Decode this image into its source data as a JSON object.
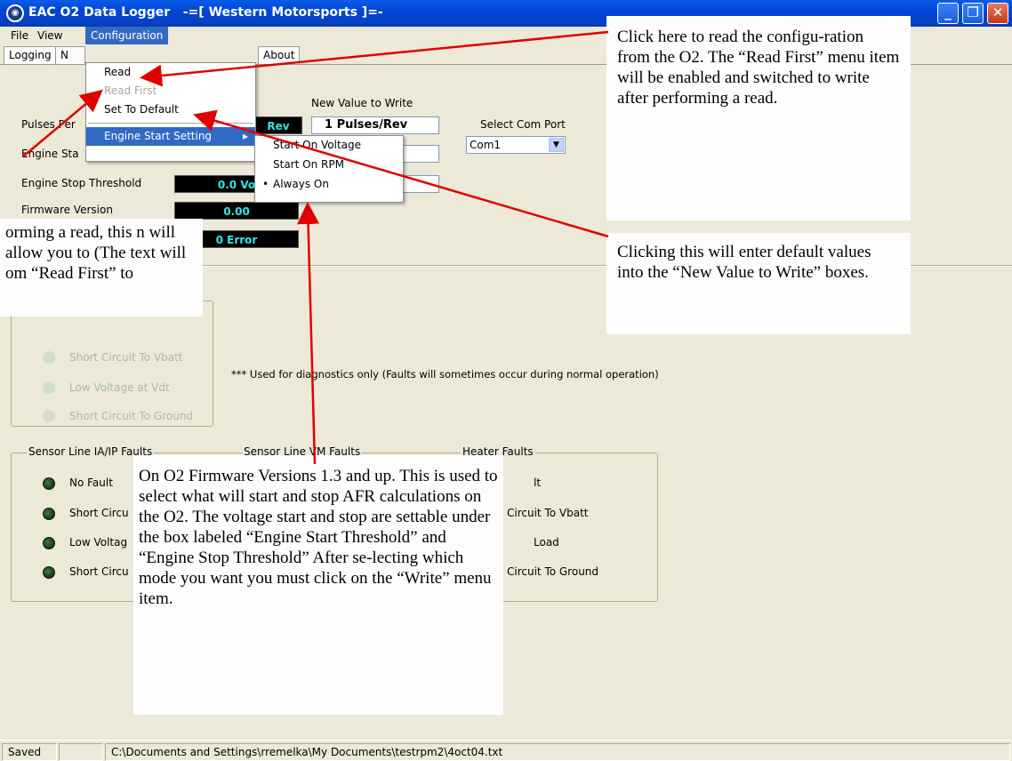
{
  "window": {
    "title": "EAC O2 Data Logger   -=[ Western Motorsports ]=-",
    "app_icon": "gecko-logo-icon",
    "minimize_icon": "minimize-icon",
    "maximize_icon": "maximize-icon",
    "close_icon": "close-icon",
    "minimize_glyph": "_",
    "maximize_glyph": "❐",
    "close_glyph": "✕"
  },
  "menubar": {
    "items": [
      "File",
      "View",
      "Configuration"
    ]
  },
  "tabs": {
    "items": [
      "Logging",
      "N",
      "About"
    ]
  },
  "configuration_menu": {
    "items": [
      {
        "label": "Read",
        "enabled": true
      },
      {
        "label": "Read First",
        "enabled": false
      },
      {
        "label": "Set To Default",
        "enabled": true
      },
      {
        "label": "Engine Start Setting",
        "enabled": true,
        "has_submenu": true
      }
    ]
  },
  "engine_start_submenu": {
    "items": [
      {
        "label": "Start On Voltage",
        "checked": false
      },
      {
        "label": "Start On RPM",
        "checked": false
      },
      {
        "label": "Always On",
        "checked": true
      }
    ],
    "bullet": "•",
    "submenu_arrow": "▸"
  },
  "config": {
    "new_value_header": "New Value to Write",
    "rows": [
      {
        "label": "Pulses Per",
        "display": "Rev",
        "new_value": "1 Pulses/Rev"
      },
      {
        "label": "Engine Sta",
        "display": "",
        "new_value": ""
      },
      {
        "label": "Engine Stop Threshold",
        "display": "0.0 Vo",
        "new_value": ""
      },
      {
        "label": "Firmware Version",
        "display": "0.00",
        "new_value": ""
      },
      {
        "label": "",
        "display": "0 Error",
        "new_value": ""
      }
    ],
    "com_port_label": "Select Com Port",
    "com_port_value": "Com1",
    "dropdown_arrow": "▼"
  },
  "diagnostics_note": "*** Used for diagnostics only (Faults will sometimes occur during normal operation)",
  "faded_group": {
    "items": [
      "Short Circuit To Vbatt",
      "Low Voltage at Vdt",
      "Short Circuit To Ground"
    ]
  },
  "fault_groups": [
    {
      "title": "Sensor Line IA/IP Faults",
      "items": [
        "No Fault",
        "Short Circu",
        "Low Voltag",
        "Short Circu"
      ]
    },
    {
      "title": "Sensor Line VM Faults",
      "items": []
    },
    {
      "title": "Heater Faults",
      "items": [
        "lt",
        "Circuit To Vbatt",
        "Load",
        "Circuit To Ground"
      ]
    }
  ],
  "callouts": {
    "read": "Click here to read the configu-ration from the O2.  The “Read First” menu item will be enabled and switched to write after performing a read.",
    "default": "Clicking this will enter default values into the “New Value to Write” boxes.",
    "readfirst": "orming a read, this n will allow you to  (The text will om “Read First” to",
    "engine": "On O2 Firmware Versions 1.3 and up. This is used to select what will start and stop AFR calculations on the O2.  The voltage start and stop are settable under the box labeled “Engine Start Threshold” and “Engine Stop Threshold” After se-lecting which mode you want you must click on the “Write” menu item."
  },
  "status": {
    "state": "Saved",
    "blank": "",
    "path": "C:\\Documents and Settings\\rremelka\\My Documents\\testrpm2\\4oct04.txt"
  },
  "colors": {
    "accent": "#316ac5",
    "arrow": "#e00000",
    "lcd_text": "#2fe6e6"
  }
}
